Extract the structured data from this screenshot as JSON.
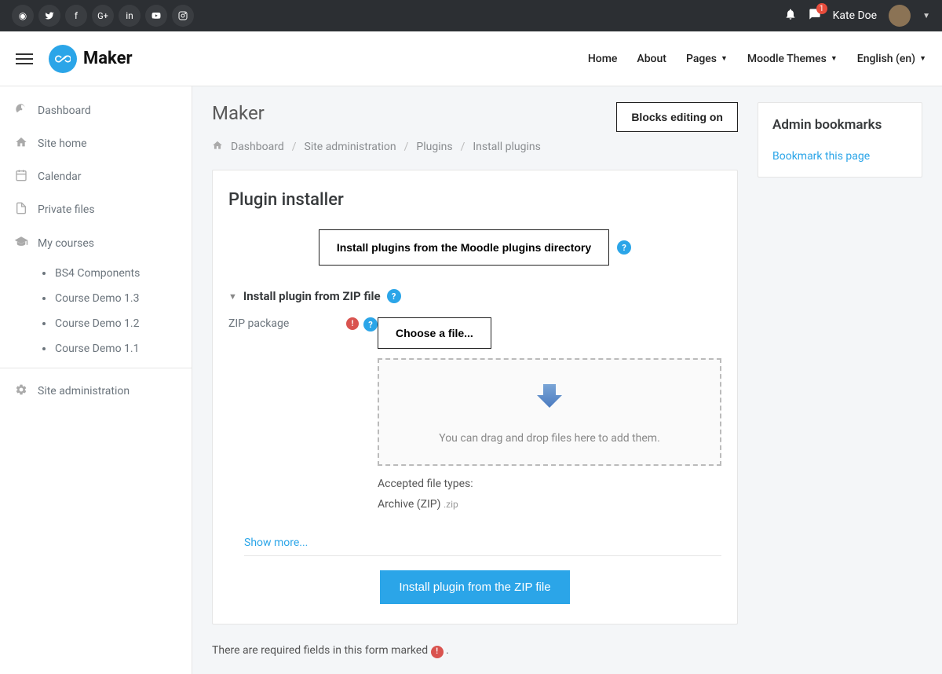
{
  "topbar": {
    "social_icons": [
      "globe-icon",
      "twitter-icon",
      "facebook-icon",
      "googleplus-icon",
      "linkedin-icon",
      "youtube-icon",
      "instagram-icon"
    ],
    "notif_count": 1,
    "username": "Kate Doe"
  },
  "header": {
    "brand": "Maker",
    "nav": [
      {
        "label": "Home",
        "dropdown": false
      },
      {
        "label": "About",
        "dropdown": false
      },
      {
        "label": "Pages",
        "dropdown": true
      },
      {
        "label": "Moodle Themes",
        "dropdown": true
      },
      {
        "label": "English (en)",
        "dropdown": true
      }
    ]
  },
  "sidebar": {
    "items": [
      {
        "icon": "tachometer-icon",
        "label": "Dashboard"
      },
      {
        "icon": "home-icon",
        "label": "Site home"
      },
      {
        "icon": "calendar-icon",
        "label": "Calendar"
      },
      {
        "icon": "files-icon",
        "label": "Private files"
      },
      {
        "icon": "graduation-cap-icon",
        "label": "My courses"
      }
    ],
    "courses": [
      "BS4 Components",
      "Course Demo 1.3",
      "Course Demo 1.2",
      "Course Demo 1.1"
    ],
    "admin_label": "Site administration"
  },
  "page": {
    "title": "Maker",
    "edit_button": "Blocks editing on",
    "breadcrumb": [
      "Dashboard",
      "Site administration",
      "Plugins",
      "Install plugins"
    ]
  },
  "installer": {
    "heading": "Plugin installer",
    "directory_button": "Install plugins from the Moodle plugins directory",
    "section_title": "Install plugin from ZIP file",
    "zip_label": "ZIP package",
    "choose_file": "Choose a file...",
    "dropzone_text": "You can drag and drop files here to add them.",
    "accepted_label": "Accepted file types:",
    "file_type_name": "Archive (ZIP)",
    "file_type_ext": ".zip",
    "show_more": "Show more...",
    "submit_button": "Install plugin from the ZIP file",
    "required_note": "There are required fields in this form marked",
    "required_note_end": "."
  },
  "aside": {
    "title": "Admin bookmarks",
    "bookmark_link": "Bookmark this page"
  },
  "colors": {
    "accent": "#2ba5e8",
    "danger": "#d9534f",
    "topbar": "#2c2f33"
  }
}
